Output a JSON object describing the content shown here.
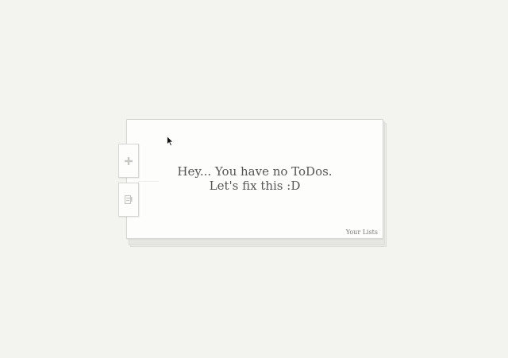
{
  "empty_state": {
    "line1": "Hey... You have no ToDos.",
    "line2": "Let's fix this :D"
  },
  "footer": {
    "your_lists_label": "Your Lists"
  },
  "side_tabs": {
    "add_icon": "plus-icon",
    "lists_icon": "list-icon"
  },
  "colors": {
    "background": "#f3f3f0",
    "paper": "#fdfdfb",
    "text": "#555555",
    "icon": "#c6c6c2"
  }
}
